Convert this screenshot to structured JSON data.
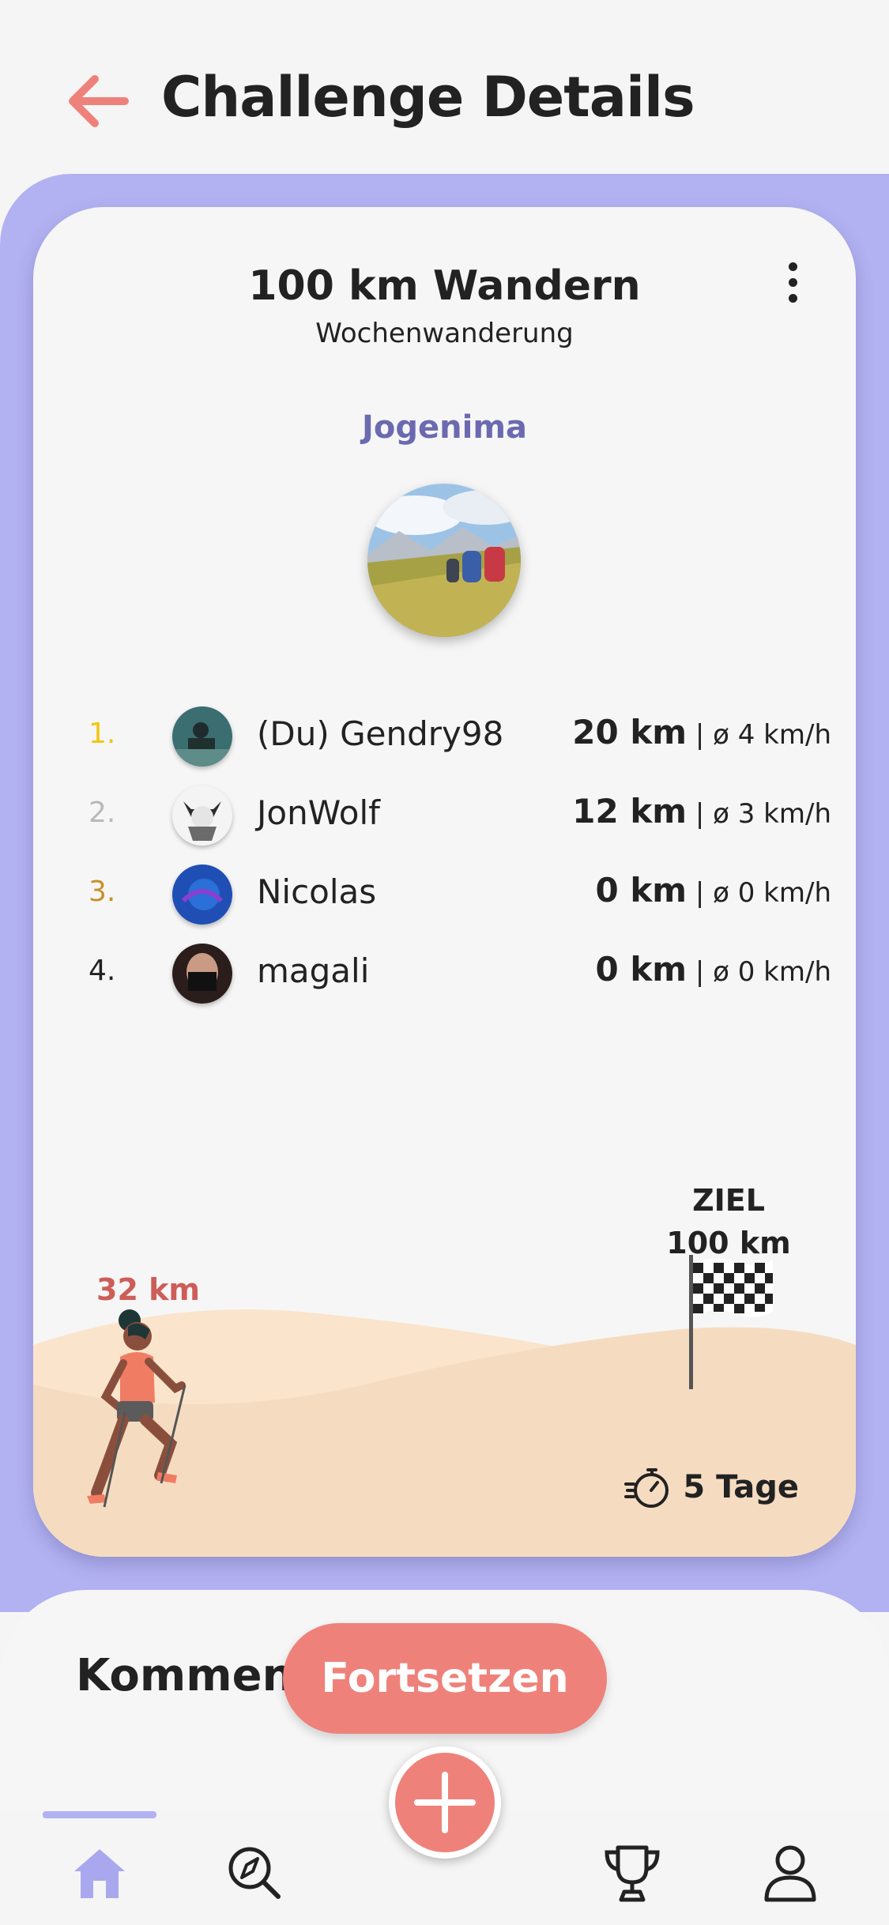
{
  "header": {
    "title": "Challenge Details"
  },
  "challenge": {
    "title": "100 km Wandern",
    "subtitle": "Wochenwanderung",
    "group_name": "Jogenima"
  },
  "leaderboard": [
    {
      "rank": "1.",
      "rank_color": "#f2c511",
      "name": "(Du) Gendry98",
      "km": "20 km",
      "speed": "| ø 4 km/h"
    },
    {
      "rank": "2.",
      "rank_color": "#b9b9b9",
      "name": "JonWolf",
      "km": "12 km",
      "speed": "| ø 3 km/h"
    },
    {
      "rank": "3.",
      "rank_color": "#c8902a",
      "name": "Nicolas",
      "km": "0 km",
      "speed": "| ø 0 km/h"
    },
    {
      "rank": "4.",
      "rank_color": "#222222",
      "name": "magali",
      "km": "0 km",
      "speed": "| ø 0 km/h"
    }
  ],
  "progress": {
    "current": "32 km",
    "fraction": 0.32,
    "goal_line1": "ZIEL",
    "goal_line2": "100 km",
    "time_left": "5 Tage"
  },
  "comments": {
    "title": "Kommentare"
  },
  "actions": {
    "continue_label": "Fortsetzen"
  },
  "nav": {
    "active_tab": "home",
    "tabs": [
      "home-icon",
      "discover-icon",
      "add-icon",
      "trophy-icon",
      "profile-icon"
    ]
  },
  "colors": {
    "accent": "#ee827a",
    "purple": "#b2b1f1",
    "group_name": "#6b6ab0",
    "progress_text": "#cd5d58"
  }
}
